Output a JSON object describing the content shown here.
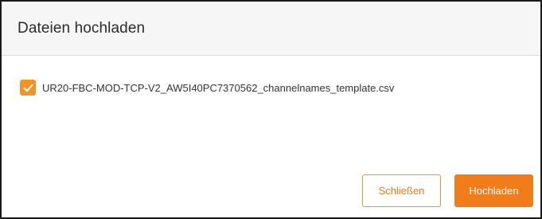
{
  "dialog": {
    "title": "Dateien hochladen",
    "files": [
      {
        "name": "UR20-FBC-MOD-TCP-V2_AW5I40PC7370562_channelnames_template.csv",
        "checked": true
      }
    ],
    "buttons": {
      "close_label": "Schließen",
      "upload_label": "Hochladen"
    }
  },
  "colors": {
    "accent": "#f39323",
    "accent_dark": "#f07d1a",
    "header_bg": "#f6f6f6"
  },
  "icons": {
    "checkbox_check": "checkmark-icon"
  }
}
